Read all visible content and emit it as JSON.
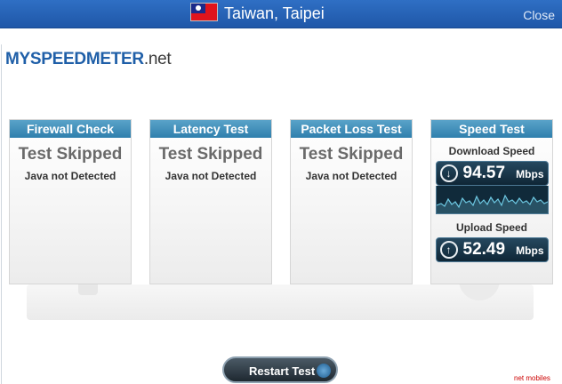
{
  "titlebar": {
    "location": "Taiwan, Taipei",
    "close_label": "Close",
    "flag_icon": "taiwan-flag-icon"
  },
  "logo": {
    "my": "MY",
    "speed": "SPEED",
    "meter": "METER",
    "net": ".net"
  },
  "panels": [
    {
      "title": "Firewall Check",
      "status": "Test Skipped",
      "detail": "Java not Detected"
    },
    {
      "title": "Latency Test",
      "status": "Test Skipped",
      "detail": "Java not Detected"
    },
    {
      "title": "Packet Loss Test",
      "status": "Test Skipped",
      "detail": "Java not Detected"
    }
  ],
  "speed_test": {
    "title": "Speed Test",
    "download": {
      "label": "Download Speed",
      "value": "94.57",
      "unit": "Mbps",
      "icon": "download-arrow-icon"
    },
    "upload": {
      "label": "Upload Speed",
      "value": "52.49",
      "unit": "Mbps",
      "icon": "upload-arrow-icon"
    }
  },
  "restart_label": "Restart Test",
  "footer_text": "net mobiles",
  "colors": {
    "titlebar": "#1f57a8",
    "panel_header": "#2f7fad",
    "speed_box": "#0f2636"
  }
}
